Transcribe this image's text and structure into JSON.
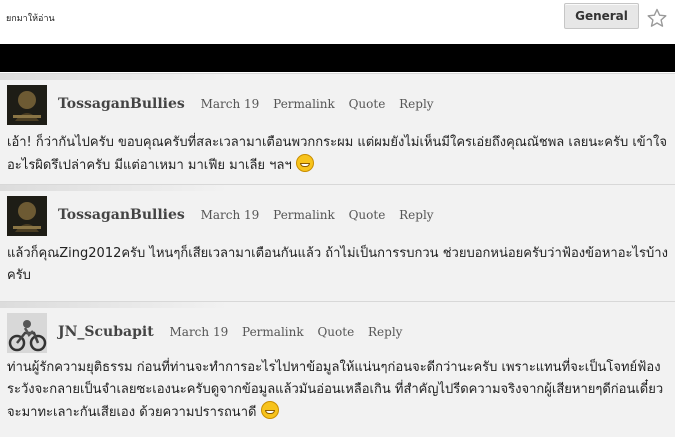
{
  "header": {
    "crumb_text": "ยกมาให้อ่าน",
    "general_label": "General",
    "star_icon": "star-outline-icon"
  },
  "comments": [
    {
      "author": "TossaganBullies",
      "date": "March 19",
      "permalink": "Permalink",
      "quote": "Quote",
      "reply": "Reply",
      "text": "เอ้า! ก็ว่ากันไปครับ ขอบคุณครับที่สละเวลามาเตือนพวกกระผม แต่ผมยังไม่เห็นมีใครเอ่ยถึงคุณณัชพล เลยนะครับ เข้าใจอะไรผิดรึเปล่าครับ มีแต่อาเหมา มาเฟีย มาเลีย ฯลฯ",
      "emoji": "grin-emoji"
    },
    {
      "author": "TossaganBullies",
      "date": "March 19",
      "permalink": "Permalink",
      "quote": "Quote",
      "reply": "Reply",
      "text": "แล้วก็คุณZing2012ครับ ไหนๆก็เสียเวลามาเตือนกันแล้ว ถ้าไม่เป็นการรบกวน ช่วยบอกหน่อยครับว่าฟ้องข้อหาอะไรบ้างครับ"
    },
    {
      "author": "JN_Scubapit",
      "date": "March 19",
      "permalink": "Permalink",
      "quote": "Quote",
      "reply": "Reply",
      "text": "ท่านผู้รักความยุติธรรม ก่อนที่ท่านจะทำการอะไรไปหาข้อมูลให้แน่นๆก่อนจะดีกว่านะครับ เพราะแทนที่จะเป็นโจทย์ฟ้องระวังจะกลายเป็นจำเลยซะเองนะครับดูจากข้อมูลแล้วมันอ่อนเหลือเกิน ที่สำคัญไปรีดความจริงจากผู้เสียหายๆดีก่อนเดี๋ยวจะมาทะเลาะกันเสียเอง ด้วยความปรารถนาดี",
      "emoji": "laugh-emoji"
    }
  ]
}
